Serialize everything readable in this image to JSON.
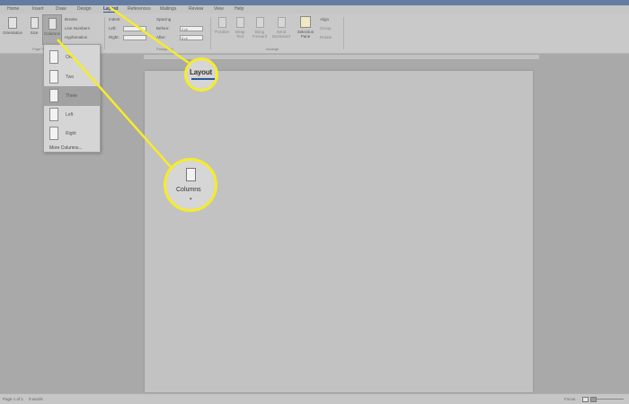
{
  "tabs": [
    {
      "label": "Home"
    },
    {
      "label": "Insert"
    },
    {
      "label": "Draw"
    },
    {
      "label": "Design"
    },
    {
      "label": "Layout"
    },
    {
      "label": "References"
    },
    {
      "label": "Mailings"
    },
    {
      "label": "Review"
    },
    {
      "label": "View"
    },
    {
      "label": "Help"
    }
  ],
  "ribbon": {
    "orientation": "Orientation",
    "size": "Size",
    "columns": "Columns",
    "breaks": "Breaks",
    "line_numbers": "Line Numbers",
    "hyphenation": "Hyphenation",
    "indent_heading": "Indent",
    "indent_left": "Left:",
    "indent_right": "Right:",
    "spacing_heading": "Spacing",
    "spacing_before": "Before:",
    "spacing_after": "After:",
    "before_value": "0 pt",
    "after_value": "8 pt",
    "group_page_setup": "Page Setup",
    "group_paragraph": "Paragraph",
    "group_arrange": "Arrange",
    "position": "Position",
    "wrap_text": "Wrap Text",
    "bring_forward": "Bring Forward",
    "send_backward": "Send Backward",
    "selection_pane": "Selection Pane",
    "align": "Align",
    "group": "Group",
    "rotate": "Rotate"
  },
  "columns_menu": {
    "items": [
      {
        "label": "One",
        "selected": false
      },
      {
        "label": "Two",
        "selected": false
      },
      {
        "label": "Three",
        "selected": true
      },
      {
        "label": "Left",
        "selected": false
      },
      {
        "label": "Right",
        "selected": false
      }
    ],
    "more": "More Columns..."
  },
  "callouts": {
    "layout_tab": "Layout",
    "columns_button": "Columns",
    "color": "#f5ec2a"
  },
  "status": {
    "page": "Page 1 of 1",
    "words": "0 words",
    "focus": "Focus"
  }
}
